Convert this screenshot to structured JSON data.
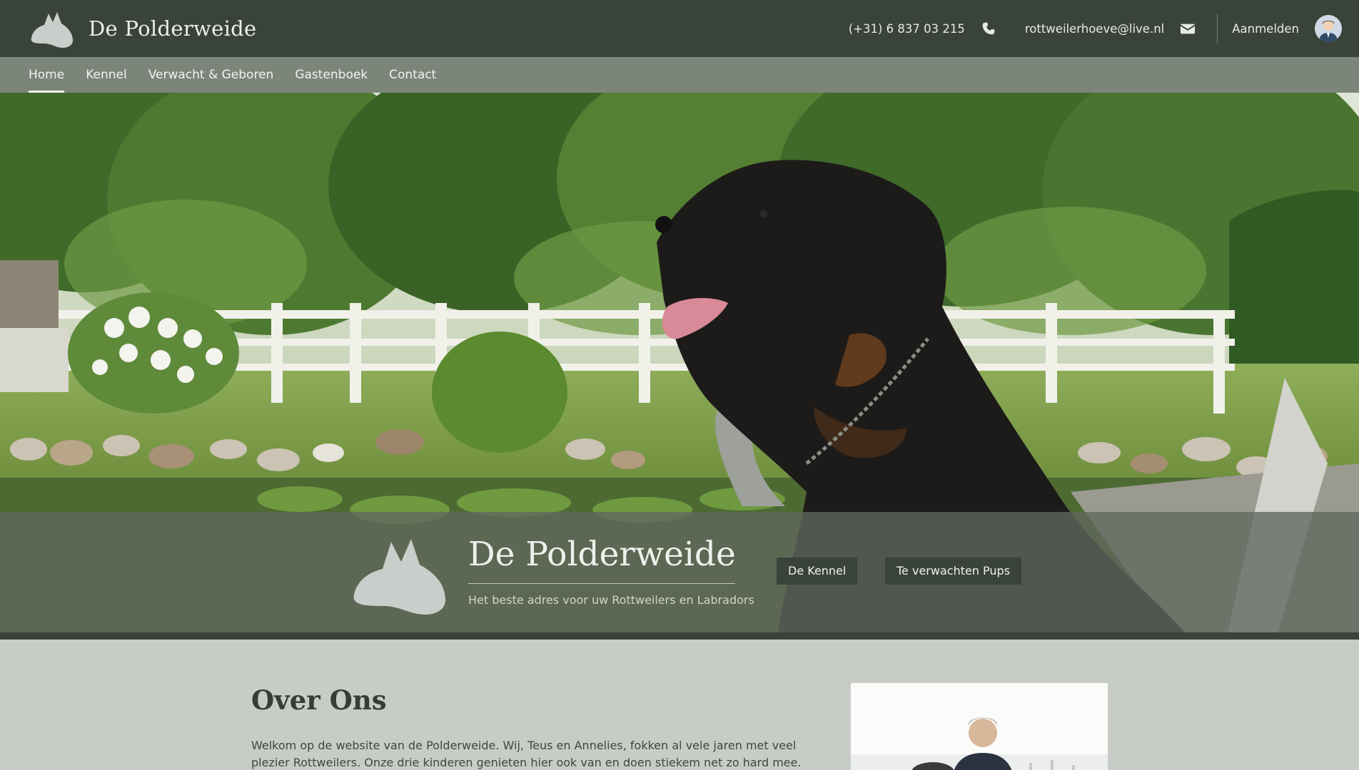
{
  "header": {
    "brand_name": "De Polderweide",
    "phone": "(+31) 6 837 03 215",
    "email": "rottweilerhoeve@live.nl",
    "login_label": "Aanmelden",
    "icons": {
      "logo": "dog-head-logo-icon",
      "phone": "phone-icon",
      "mail": "envelope-icon",
      "avatar": "user-avatar-icon"
    }
  },
  "nav": {
    "items": [
      {
        "label": "Home",
        "active": true
      },
      {
        "label": "Kennel",
        "active": false
      },
      {
        "label": "Verwacht & Geboren",
        "active": false
      },
      {
        "label": "Gastenboek",
        "active": false
      },
      {
        "label": "Contact",
        "active": false
      }
    ]
  },
  "hero": {
    "title": "De Polderweide",
    "tagline": "Het beste adres voor uw Rottweilers en Labradors",
    "buttons": {
      "kennel": "De Kennel",
      "pups": "Te verwachten Pups"
    }
  },
  "about": {
    "title": "Over Ons",
    "text": "Welkom op de website van de Polderweide. Wij, Teus en Annelies, fokken al vele jaren met veel plezier Rottweilers. Onze drie kinderen genieten hier ook van en doen stiekem net zo hard mee. Dit doen we in"
  },
  "colors": {
    "topbar": "#3a4339",
    "nav": "#7c8579",
    "page_bg": "#c8ccc6",
    "button_bg": "#3a4339"
  }
}
